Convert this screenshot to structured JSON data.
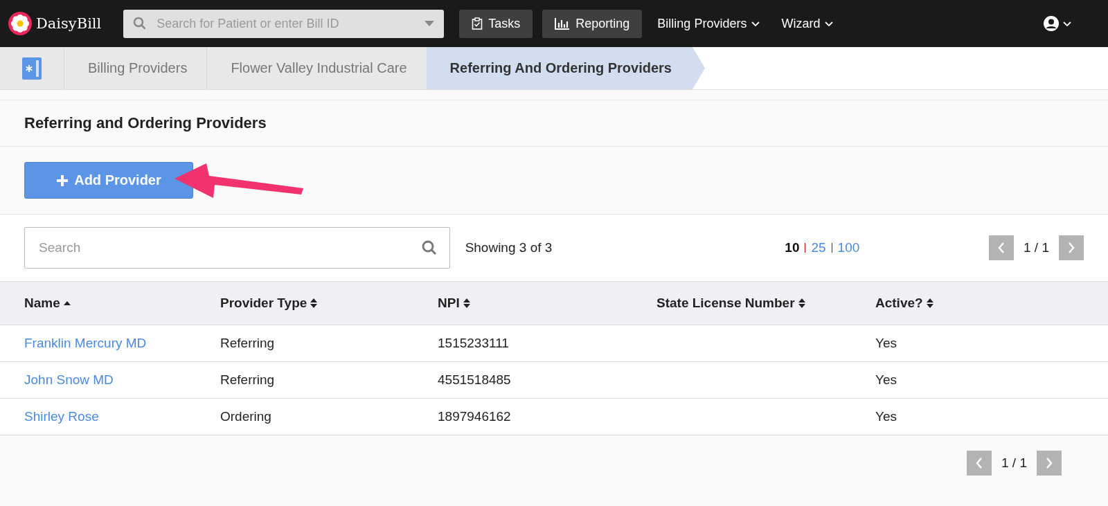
{
  "navbar": {
    "brand": "DaisyBill",
    "search": {
      "placeholder": "Search for Patient or enter Bill ID"
    },
    "items": [
      {
        "label": "Tasks",
        "kind": "button"
      },
      {
        "label": "Reporting",
        "kind": "button"
      },
      {
        "label": "Billing Providers",
        "kind": "menu"
      },
      {
        "label": "Wizard",
        "kind": "menu"
      }
    ]
  },
  "breadcrumbs": [
    {
      "label": "Billing Providers",
      "selected": false
    },
    {
      "label": "Flower Valley Industrial Care",
      "selected": false
    },
    {
      "label": "Referring And Ordering Providers",
      "selected": true
    }
  ],
  "page_title": "Referring and Ordering Providers",
  "add_button": "Add Provider",
  "list": {
    "search": {
      "placeholder": "Search"
    },
    "showing": "Showing 3 of 3",
    "page_sizes": [
      {
        "label": "10",
        "selected": true
      },
      {
        "label": "25",
        "selected": false
      },
      {
        "label": "100",
        "selected": false
      }
    ],
    "pager": "1 / 1"
  },
  "table": {
    "columns": [
      {
        "label": "Name",
        "sorted": true
      },
      {
        "label": "Provider Type",
        "sorted": false
      },
      {
        "label": "NPI",
        "sorted": false
      },
      {
        "label": "State License Number",
        "sorted": false
      },
      {
        "label": "Active?",
        "sorted": false
      }
    ],
    "rows": [
      [
        "Franklin Mercury MD",
        "Referring",
        "1515233111",
        "",
        "Yes"
      ],
      [
        "John Snow MD",
        "Referring",
        "4551518485",
        "",
        "Yes"
      ],
      [
        "Shirley Rose",
        "Ordering",
        "1897946162",
        "",
        "Yes"
      ]
    ]
  },
  "bottom_pager": "1 / 1"
}
